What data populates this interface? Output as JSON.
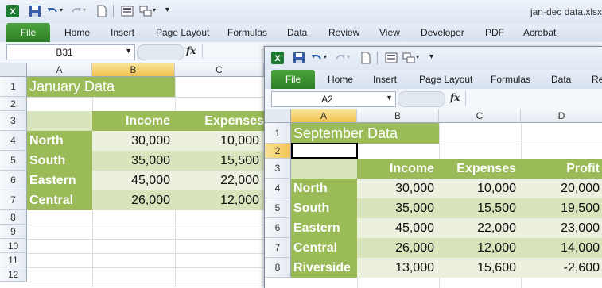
{
  "colors": {
    "accent": "#9bbb59",
    "light_row": "#ebf1de",
    "mid_row": "#d8e4bc",
    "file_tab": "#3b8f2f"
  },
  "window_back": {
    "title": "jan-dec data.xlsx",
    "tabs": [
      "Home",
      "Insert",
      "Page Layout",
      "Formulas",
      "Data",
      "Review",
      "View",
      "Developer",
      "PDF",
      "Acrobat"
    ],
    "file_tab": "File",
    "name_box": "B31",
    "fx_label": "fx",
    "columns": [
      "A",
      "B",
      "C"
    ],
    "selected_column": "B",
    "rows": [
      "1",
      "2",
      "3",
      "4",
      "5",
      "6",
      "7",
      "8",
      "9",
      "10",
      "11",
      "12"
    ],
    "sheet": {
      "title": "January Data",
      "headers": [
        "Income",
        "Expenses"
      ],
      "data": [
        {
          "label": "North",
          "values": [
            "30,000",
            "10,000"
          ]
        },
        {
          "label": "South",
          "values": [
            "35,000",
            "15,500"
          ]
        },
        {
          "label": "Eastern",
          "values": [
            "45,000",
            "22,000"
          ]
        },
        {
          "label": "Central",
          "values": [
            "26,000",
            "12,000"
          ]
        }
      ]
    }
  },
  "window_front": {
    "tabs": [
      "Home",
      "Insert",
      "Page Layout",
      "Formulas",
      "Data",
      "Re"
    ],
    "file_tab": "File",
    "name_box": "A2",
    "fx_label": "fx",
    "columns": [
      "A",
      "B",
      "C",
      "D"
    ],
    "selected_column": "A",
    "rows": [
      "1",
      "2",
      "3",
      "4",
      "5",
      "6",
      "7",
      "8"
    ],
    "selected_row": "2",
    "sheet": {
      "title": "September Data",
      "headers": [
        "Income",
        "Expenses",
        "Profit"
      ],
      "data": [
        {
          "label": "North",
          "values": [
            "30,000",
            "10,000",
            "20,000"
          ]
        },
        {
          "label": "South",
          "values": [
            "35,000",
            "15,500",
            "19,500"
          ]
        },
        {
          "label": "Eastern",
          "values": [
            "45,000",
            "22,000",
            "23,000"
          ]
        },
        {
          "label": "Central",
          "values": [
            "26,000",
            "12,000",
            "14,000"
          ]
        },
        {
          "label": "Riverside",
          "values": [
            "13,000",
            "15,600",
            "-2,600"
          ]
        }
      ]
    }
  }
}
